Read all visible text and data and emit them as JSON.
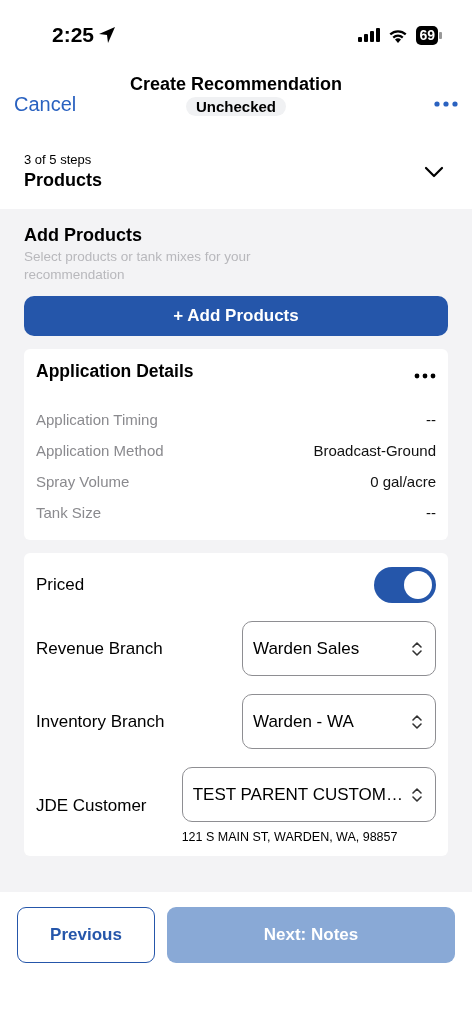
{
  "status_bar": {
    "time": "2:25",
    "battery": "69"
  },
  "nav": {
    "cancel": "Cancel",
    "title": "Create Recommendation",
    "status_badge": "Unchecked"
  },
  "stepper": {
    "progress": "3 of 5 steps",
    "current_step": "Products",
    "expanded": false
  },
  "add_products": {
    "title": "Add Products",
    "subtitle": "Select products or tank mixes for your recommendation",
    "button": "+ Add Products"
  },
  "application_details": {
    "title": "Application Details",
    "rows": [
      {
        "label": "Application Timing",
        "value": "--"
      },
      {
        "label": "Application Method",
        "value": "Broadcast-Ground"
      },
      {
        "label": "Spray Volume",
        "value": "0 gal/acre"
      },
      {
        "label": "Tank Size",
        "value": "--"
      }
    ]
  },
  "settings": [
    {
      "kind": "toggle",
      "label": "Priced",
      "on": true
    },
    {
      "kind": "select",
      "label": "Revenue Branch",
      "value": "Warden Sales"
    },
    {
      "kind": "select",
      "label": "Inventory Branch",
      "value": "Warden - WA"
    },
    {
      "kind": "select",
      "label": "JDE Customer",
      "value": "TEST PARENT CUSTOM…",
      "note": "121 S MAIN ST, WARDEN, WA, 98857"
    }
  ],
  "footer": {
    "previous": "Previous",
    "next": "Next: Notes",
    "next_disabled": true
  }
}
